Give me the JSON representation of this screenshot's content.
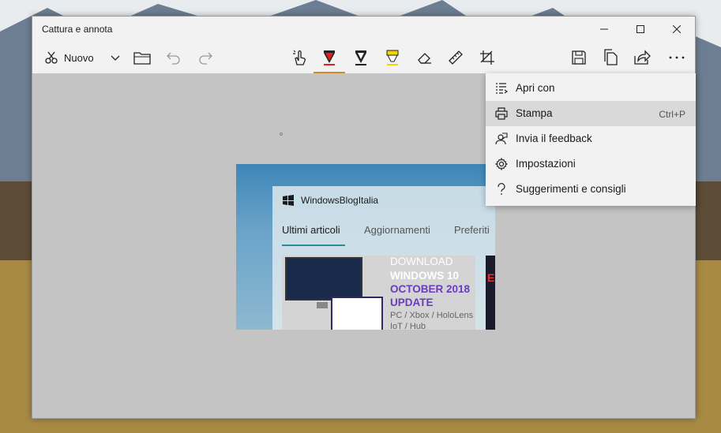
{
  "window": {
    "title": "Cattura e annota",
    "controls": [
      "minimize-icon",
      "maximize-icon",
      "close-icon"
    ]
  },
  "toolbar": {
    "new_label": "Nuovo",
    "left_icons": [
      "snip-icon",
      "chevron-down-icon",
      "folder-icon",
      "undo-icon",
      "redo-icon"
    ],
    "center_icons": [
      "touch-writing-icon",
      "ballpoint-pen-icon",
      "pencil-icon",
      "highlighter-icon",
      "eraser-icon",
      "ruler-icon",
      "crop-icon"
    ],
    "right_icons": [
      "save-icon",
      "copy-icon",
      "share-icon",
      "more-icon"
    ],
    "accent_color": "#d08a2a"
  },
  "capture": {
    "brand": "WindowsBlogItalia",
    "tabs": [
      "Ultimi articoli",
      "Aggiornamenti",
      "Preferiti"
    ],
    "active_tab": "Ultimi articoli",
    "article": {
      "line1": "DOWNLOAD",
      "line2": "WINDOWS 10",
      "line3": "OCTOBER 2018",
      "line4": "UPDATE",
      "line5": "PC / Xbox / HoloLens",
      "line6": "IoT / Hub"
    },
    "side_text": "E"
  },
  "menu": {
    "items": [
      {
        "label": "Apri con",
        "icon": "open-with-icon",
        "shortcut": ""
      },
      {
        "label": "Stampa",
        "icon": "printer-icon",
        "shortcut": "Ctrl+P"
      },
      {
        "label": "Invia il feedback",
        "icon": "feedback-icon",
        "shortcut": ""
      },
      {
        "label": "Impostazioni",
        "icon": "gear-icon",
        "shortcut": ""
      },
      {
        "label": "Suggerimenti e consigli",
        "icon": "question-icon",
        "shortcut": ""
      }
    ],
    "hovered_index": 1
  }
}
